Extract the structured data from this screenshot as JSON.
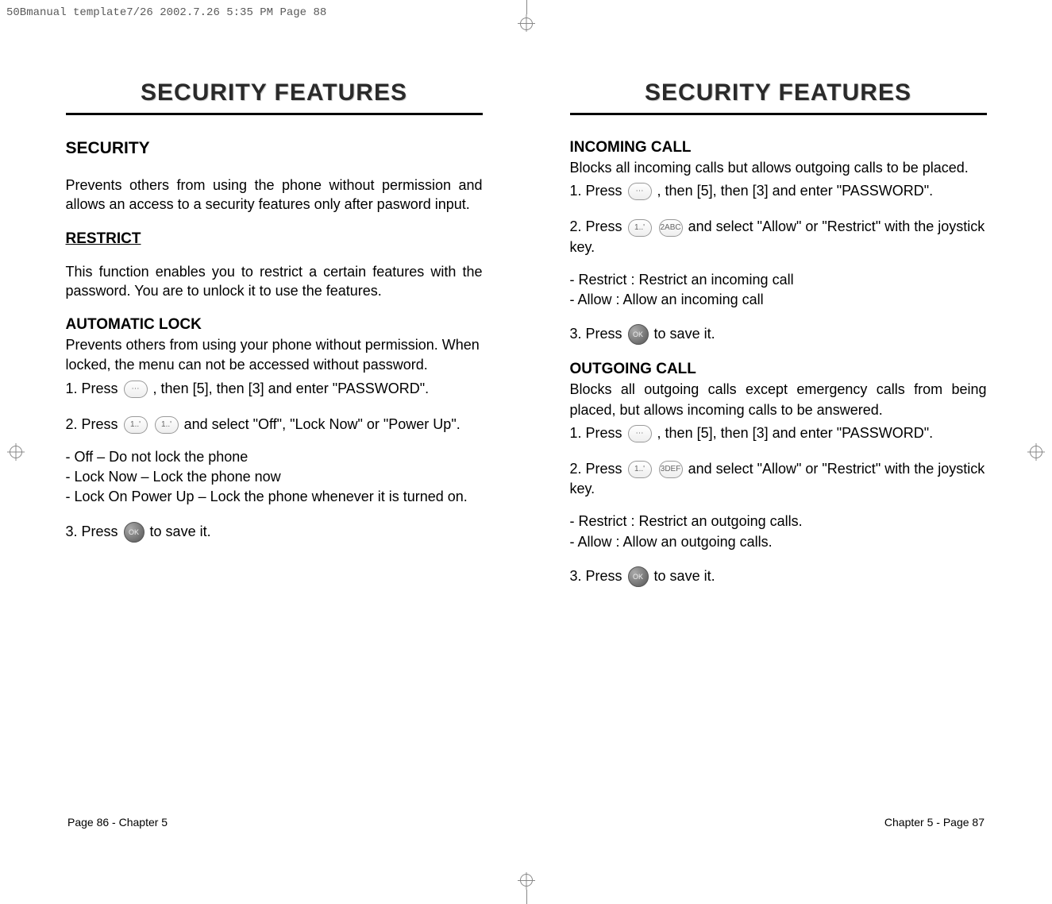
{
  "header": "50Bmanual template7/26  2002.7.26  5:35 PM  Page 88",
  "title_left": "SECURITY FEATURES",
  "title_right": "SECURITY FEATURES",
  "left": {
    "security_heading": "SECURITY",
    "security_para": "Prevents others from using the phone without permission and allows an access to a security features only after pasword input.",
    "restrict_heading": "RESTRICT",
    "restrict_para": "This function enables you to restrict a certain features with the password. You are to unlock it to use the features.",
    "auto_lock_heading": "AUTOMATIC LOCK",
    "auto_lock_para": "Prevents others from using your phone without permission. When locked, the menu can not be accessed without password.",
    "auto_step1_a": "1. Press ",
    "auto_step1_b": " , then [5], then [3] and enter \"PASSWORD\".",
    "auto_step2_a": "2. Press  ",
    "auto_step2_b": "  and select \"Off\", \"Lock Now\" or \"Power Up\".",
    "auto_list1": "- Off – Do not lock the phone",
    "auto_list2": "- Lock Now – Lock the phone now",
    "auto_list3": "- Lock On Power Up – Lock the phone whenever it is turned on.",
    "auto_step3_a": "3. Press ",
    "auto_step3_b": " to save it."
  },
  "right": {
    "incoming_heading": "INCOMING CALL",
    "incoming_para": "Blocks all incoming calls but allows outgoing calls to be placed.",
    "inc_step1_a": "1. Press ",
    "inc_step1_b": " , then [5], then [3] and enter \"PASSWORD\".",
    "inc_step2_a": "2. Press ",
    "inc_step2_b": " and select \"Allow\" or \"Restrict\" with the joystick key.",
    "inc_list1": "- Restrict : Restrict an incoming call",
    "inc_list2": "- Allow : Allow an incoming call",
    "inc_step3_a": "3. Press ",
    "inc_step3_b": " to save it.",
    "outgoing_heading": "OUTGOING CALL",
    "outgoing_para": "Blocks all outgoing calls except emergency calls from being placed, but allows incoming calls to be answered.",
    "out_step1_a": "1. Press ",
    "out_step1_b": " , then [5], then [3] and enter \"PASSWORD\".",
    "out_step2_a": "2. Press ",
    "out_step2_b": " and select \"Allow\" or \"Restrict\" with the joystick key.",
    "out_list1": "- Restrict : Restrict an outgoing calls.",
    "out_list2": "- Allow : Allow an outgoing calls.",
    "out_step3_a": "3. Press ",
    "out_step3_b": " to save it."
  },
  "icons": {
    "menu": "⋯",
    "one": "1..'",
    "two": "2ABC",
    "three": "3DEF",
    "ok": "OK"
  },
  "footer_left": "Page 86 - Chapter 5",
  "footer_right": "Chapter 5 - Page 87"
}
